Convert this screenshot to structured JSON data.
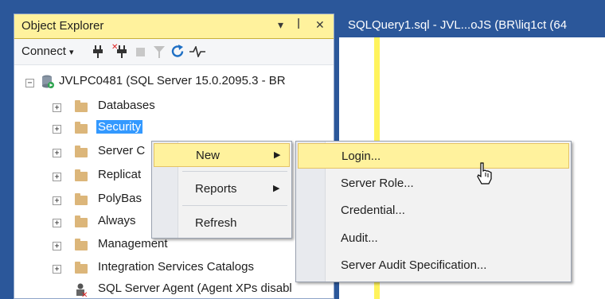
{
  "object_explorer": {
    "title": "Object Explorer",
    "header_buttons": {
      "dropdown": "▾",
      "pin": "ꟾ",
      "close": "✕"
    },
    "toolbar": {
      "connect_label": "Connect",
      "connect_arrow": "▾"
    },
    "server_node": "JVLPC0481 (SQL Server 15.0.2095.3 - BR",
    "tree": [
      {
        "label": "Databases"
      },
      {
        "label": "Security"
      },
      {
        "label": "Server C"
      },
      {
        "label": "Replicat"
      },
      {
        "label": "PolyBas"
      },
      {
        "label": "Always"
      },
      {
        "label": "Management"
      },
      {
        "label": "Integration Services Catalogs"
      }
    ],
    "agent_node": "SQL Server Agent (Agent XPs disabl",
    "expander": "+",
    "root_expander": "−"
  },
  "query_tab": {
    "label": "SQLQuery1.sql - JVL...oJS (BR\\liq1ct (64"
  },
  "context_menu": {
    "items": [
      {
        "label": "New",
        "arrow": "▶"
      },
      {
        "label": "Reports",
        "arrow": "▶"
      },
      {
        "label": "Refresh"
      }
    ]
  },
  "submenu": {
    "items": [
      {
        "label": "Login..."
      },
      {
        "label": "Server Role..."
      },
      {
        "label": "Credential..."
      },
      {
        "label": "Audit..."
      },
      {
        "label": "Server Audit Specification..."
      }
    ]
  },
  "colors": {
    "background": "#2b579a",
    "header_highlight": "#fff29d",
    "selection": "#3399ff",
    "folder": "#dcb67a",
    "gutter": "#fff35c"
  }
}
